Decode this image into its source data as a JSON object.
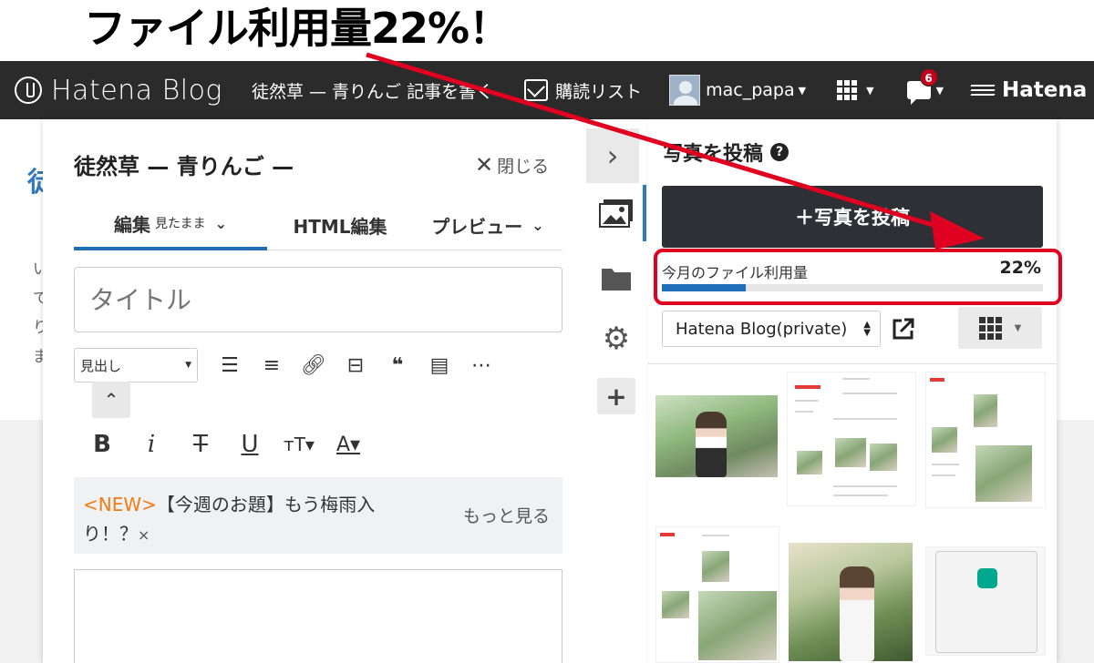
{
  "annotation": {
    "title": "ファイル利用量22%！",
    "arrow_color": "#e00020"
  },
  "topbar": {
    "logo_text": "Hatena Blog",
    "blog_title": "徒然草 — 青りんご",
    "write_link": "記事を書く",
    "reading_list": "購読リスト",
    "username": "mac_papa",
    "notification_count": "6",
    "brand": "Hatena"
  },
  "background": {
    "heading_char": "徒",
    "lines": [
      "い",
      "て",
      "り",
      "ま"
    ]
  },
  "editor": {
    "header": "徒然草 — 青りんご —",
    "close_label": "閉じる",
    "tabs": [
      {
        "label": "編集",
        "sub": "見たまま",
        "active": true
      },
      {
        "label": "HTML編集",
        "active": false
      },
      {
        "label": "プレビュー",
        "active": false
      }
    ],
    "title_placeholder": "タイトル",
    "heading_select": "見出し",
    "notice": {
      "new_tag": "<NEW>",
      "text": "【今週のお題】もう梅雨入り！？",
      "dismiss": "×",
      "more": "もっと見る"
    }
  },
  "side_nav": {
    "items": [
      "expand-icon",
      "photo-icon",
      "folder-icon",
      "gear-icon",
      "plus-icon"
    ]
  },
  "photo_panel": {
    "title": "写真を投稿",
    "upload_button": "＋写真を投稿",
    "usage_label": "今月のファイル利用量",
    "usage_value": "22%",
    "usage_fraction": 0.22,
    "blog_select": "Hatena Blog(private)",
    "accent_color": "#1f6fb8"
  },
  "colors": {
    "topbar": "#2b2b2b",
    "new_tag": "#f07b14",
    "badge": "#c4001a",
    "upload_button": "#2e3035"
  }
}
